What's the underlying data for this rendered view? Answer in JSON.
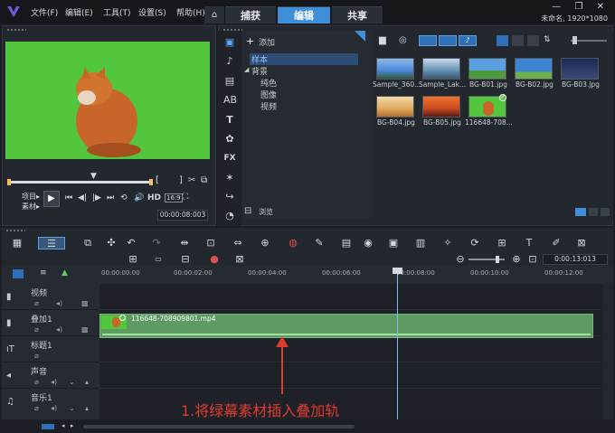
{
  "app": {
    "menus": [
      "文件(F)",
      "编辑(E)",
      "工具(T)",
      "设置(S)",
      "帮助(H)"
    ],
    "tabs": [
      "捕获",
      "编辑",
      "共享"
    ],
    "active_tab": "编辑",
    "project_info": "未命名, 1920*1080",
    "window_controls": "— ❐ ✕"
  },
  "preview": {
    "project_label": "项目▸",
    "clip_label": "素材▸",
    "hd": "HD",
    "timecode": "00:00:08:003"
  },
  "library": {
    "add_label": "添加",
    "tree": {
      "samples": "样本",
      "background": "背景",
      "solid_color": "纯色",
      "image": "图像",
      "video": "视频"
    },
    "browse_label": "浏览",
    "thumbs": [
      {
        "label": "Sample_360...",
        "color": "#4a88d8"
      },
      {
        "label": "Sample_Lak...",
        "color": "#6a98b8"
      },
      {
        "label": "BG-B01.jpg",
        "color": "#5aa0e0"
      },
      {
        "label": "BG-B02.jpg",
        "color": "#3d86d4"
      },
      {
        "label": "BG-B03.jpg",
        "color": "#1c2a56"
      },
      {
        "label": "BG-B04.jpg",
        "color": "#e0a85a"
      },
      {
        "label": "BG-B05.jpg",
        "color": "#c84a22"
      },
      {
        "label": "116648-708...",
        "color": "#53c63d"
      }
    ]
  },
  "timeline": {
    "zoom_timecode": "0:00:13:013",
    "ruler": [
      "00:00:00:00",
      "00:00:02:00",
      "00:00:04:00",
      "00:00:06:00",
      "00:00:08:00",
      "00:00:10:00",
      "00:00:12:00"
    ],
    "tracks": [
      {
        "name": "视频",
        "icon": "video-track-icon"
      },
      {
        "name": "叠加1",
        "icon": "overlay-track-icon"
      },
      {
        "name": "标题1",
        "icon": "title-track-icon"
      },
      {
        "name": "声音",
        "icon": "voice-track-icon"
      },
      {
        "name": "音乐1",
        "icon": "music-track-icon"
      }
    ],
    "clip_name": "116648-708909801.mp4"
  },
  "annotation": "1.将绿幕素材插入叠加轨"
}
